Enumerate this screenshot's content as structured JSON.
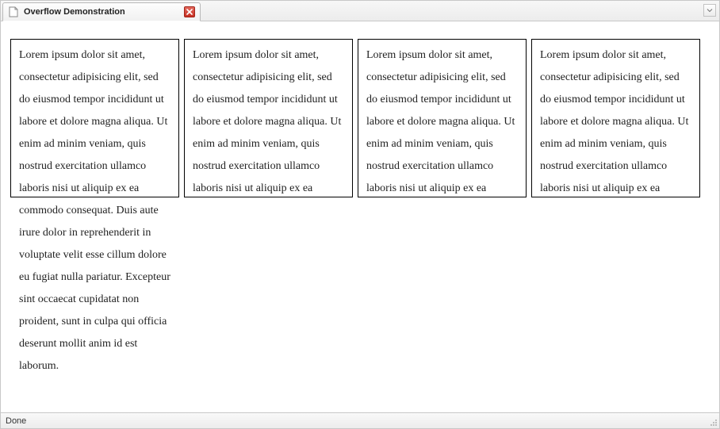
{
  "tab": {
    "title": "Overflow Demonstration"
  },
  "statusbar": {
    "text": "Done"
  },
  "lorem": "Lorem ipsum dolor sit amet, consectetur adipisicing elit, sed do eiusmod tempor incididunt ut labore et dolore magna aliqua. Ut enim ad minim veniam, quis nostrud exercitation ullamco laboris nisi ut aliquip ex ea commodo consequat. Duis aute irure dolor in reprehenderit in voluptate velit esse cillum dolore eu fugiat nulla pariatur. Excepteur sint occaecat cupidatat non proident, sunt in culpa qui officia deserunt mollit anim id est laborum.",
  "boxes": [
    {
      "overflow": "visible"
    },
    {
      "overflow": "scroll"
    },
    {
      "overflow": "auto"
    },
    {
      "overflow": "hidden"
    }
  ]
}
